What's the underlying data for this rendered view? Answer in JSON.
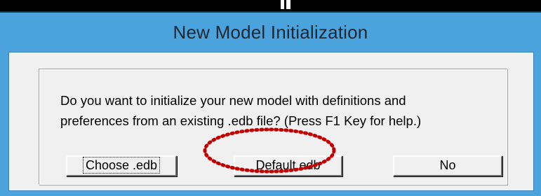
{
  "window": {
    "title": "New Model Initialization"
  },
  "dialog": {
    "message": "Do you want to initialize your new model with definitions and\npreferences from an existing .edb file? (Press F1 Key for help.)",
    "buttons": {
      "choose": "Choose .edb",
      "default": "Default.edb",
      "no": "No"
    }
  },
  "colors": {
    "frame": "#4aa3dc",
    "face": "#f0f0f0",
    "annotation": "#c00000"
  }
}
